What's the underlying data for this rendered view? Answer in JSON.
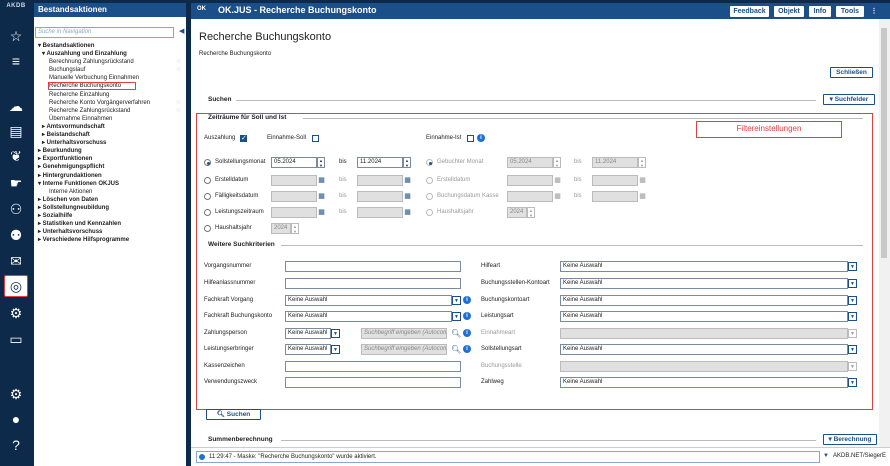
{
  "rail": {
    "logo": "AKDB",
    "icons": [
      "star-icon",
      "menu-icon",
      "cloud-person-icon",
      "badge-icon",
      "heart-hand-icon",
      "hand-money-icon",
      "handshake-icon",
      "family-icon",
      "mail-icon",
      "target-icon",
      "person-settings-icon",
      "document-gear-icon",
      "settings-icon",
      "user-icon",
      "help-icon"
    ]
  },
  "nav": {
    "title": "Bestandsaktionen",
    "search_placeholder": "Suche in Navigation",
    "items": [
      {
        "t": "▾ Bestandsaktionen",
        "lvl": 0,
        "b": true
      },
      {
        "t": "▾ Auszahlung und Einzahlung",
        "lvl": 1,
        "b": true
      },
      {
        "t": "Berechnung Zahlungsrückstand",
        "lvl": 2,
        "star": true
      },
      {
        "t": "Buchungslauf",
        "lvl": 2,
        "star": true
      },
      {
        "t": "Manuelle Verbuchung Einnahmen",
        "lvl": 2
      },
      {
        "t": "Recherche Buchungskonto",
        "lvl": 2,
        "sel": true
      },
      {
        "t": "Recherche Einzahlung",
        "lvl": 2
      },
      {
        "t": "Recherche Konto Vorgängerverfahren",
        "lvl": 2,
        "star": true
      },
      {
        "t": "Recherche Zahlungsrückstand",
        "lvl": 2,
        "star": true
      },
      {
        "t": "Übernahme Einnahmen",
        "lvl": 2
      },
      {
        "t": "▸ Amtsvormundschaft",
        "lvl": 1,
        "b": true
      },
      {
        "t": "▸ Beistandschaft",
        "lvl": 1,
        "b": true
      },
      {
        "t": "▸ Unterhaltsvorschuss",
        "lvl": 1,
        "b": true
      },
      {
        "t": "▸ Beurkundung",
        "lvl": 0,
        "b": true
      },
      {
        "t": "▸ Exportfunktionen",
        "lvl": 0,
        "b": true
      },
      {
        "t": "▸ Genehmigungspflicht",
        "lvl": 0,
        "b": true
      },
      {
        "t": "▸ Hintergrundaktionen",
        "lvl": 0,
        "b": true
      },
      {
        "t": "▾ Interne Funktionen OKJUS",
        "lvl": 0,
        "b": true
      },
      {
        "t": "Interne Aktionen",
        "lvl": 2
      },
      {
        "t": "▸ Löschen von Daten",
        "lvl": 0,
        "b": true
      },
      {
        "t": "▸ Sollstellungneubildung",
        "lvl": 0,
        "b": true
      },
      {
        "t": "▸ Sozialhilfe",
        "lvl": 0,
        "b": true
      },
      {
        "t": "▸ Statistiken und Kennzahlen",
        "lvl": 0,
        "b": true
      },
      {
        "t": "▸ Unterhaltsvorschuss",
        "lvl": 0,
        "b": true
      },
      {
        "t": "▸ Verschiedene Hilfsprogramme",
        "lvl": 0,
        "b": true
      }
    ]
  },
  "topbar": {
    "brand": "OK",
    "title": "OK.JUS - Recherche Buchungskonto",
    "buttons": [
      "Feedback",
      "Objekt",
      "Info",
      "Tools"
    ]
  },
  "page": {
    "title": "Recherche Buchungskonto",
    "subtitle": "Recherche Buchungskonto",
    "close_btn": "Schließen",
    "search_section": "Suchen",
    "search_fields_btn": "▾ Suchfelder",
    "time_section": "Zeiträume für Soll und Ist",
    "filter_label": "Filtereinstellungen",
    "auszahlung": "Auszahlung",
    "einnahme_soll": "Einnahme-Soll",
    "einnahme_ist": "Einnahme-Ist",
    "bis": "bis",
    "left_rows": [
      "Sollstellungsmonat",
      "Erstelldatum",
      "Fälligkeitsdatum",
      "Leistungszeitraum",
      "Haushaltsjahr"
    ],
    "right_rows": [
      "Gebuchter Monat",
      "Erstelldatum",
      "Buchungsdatum Kasse",
      "Haushaltsjahr"
    ],
    "soll_from": "05.2024",
    "soll_to": "11.2024",
    "geb_from": "05.2024",
    "geb_to": "11.2024",
    "hhj_left": "2024",
    "hhj_right": "2024",
    "further_section": "Weitere Suchkriterien",
    "crit_left": [
      "Vorgangsnummer",
      "Hilfeanlassnummer",
      "Fachkraft Vorgang",
      "Fachkraft Buchungskonto",
      "Zahlungsperson",
      "Leistungserbringer",
      "Kassenzeichen",
      "Verwendungszweck"
    ],
    "crit_right": [
      "Hilfeart",
      "Buchungsstellen-Kontoart",
      "Buchungskontoart",
      "Leistungsart",
      "Einnahmeart",
      "Sollstellungsart",
      "Buchungsstelle",
      "Zahlweg"
    ],
    "keine": "Keine Auswahl",
    "autocomplete": "Suchbegriff eingeben (Autocomplete)",
    "search_btn": "Suchen",
    "sum_section": "Summenberechnung",
    "sum_btn": "▾ Berechnung"
  },
  "status": {
    "message": "11:29:47 - Maske: \"Recherche Buchungskonto\" wurde aktiviert.",
    "user": "AKDB.NET/SiegerE"
  }
}
